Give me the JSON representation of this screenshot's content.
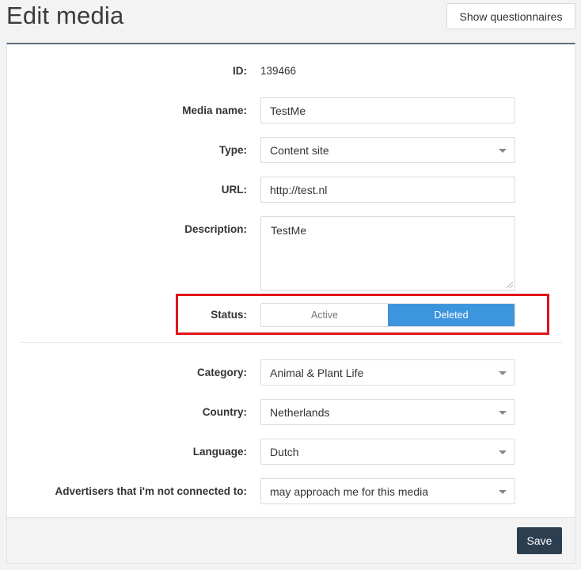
{
  "header": {
    "title": "Edit media",
    "questionnaires_button": "Show questionnaires"
  },
  "form": {
    "id": {
      "label": "ID:",
      "value": "139466"
    },
    "media_name": {
      "label": "Media name:",
      "value": "TestMe"
    },
    "type": {
      "label": "Type:",
      "value": "Content site"
    },
    "url": {
      "label": "URL:",
      "value": "http://test.nl"
    },
    "description": {
      "label": "Description:",
      "value": "TestMe"
    },
    "status": {
      "label": "Status:",
      "options": [
        "Active",
        "Deleted"
      ],
      "selected": "Deleted"
    },
    "category": {
      "label": "Category:",
      "value": "Animal & Plant Life"
    },
    "country": {
      "label": "Country:",
      "value": "Netherlands"
    },
    "language": {
      "label": "Language:",
      "value": "Dutch"
    },
    "advertisers": {
      "label": "Advertisers that i'm not connected to:",
      "value": "may approach me for this media"
    }
  },
  "footer": {
    "save_label": "Save"
  },
  "colors": {
    "accent": "#3d95de",
    "save_button": "#2d3e50",
    "highlight": "#e3141b",
    "card_top_border": "#5b6a7c"
  }
}
